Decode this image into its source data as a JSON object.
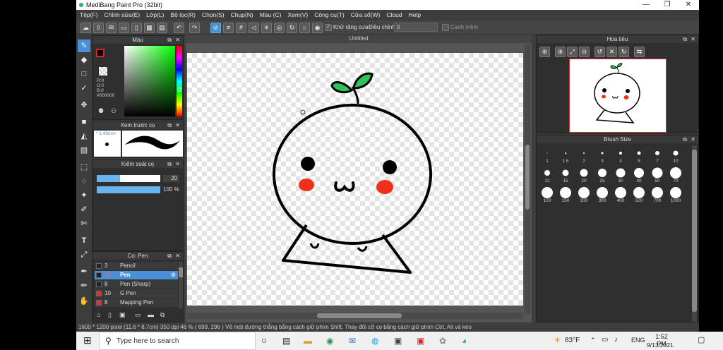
{
  "window": {
    "title": "MediBang Paint Pro (32bit)",
    "min": "—",
    "max": "❐",
    "close": "✕"
  },
  "menu": [
    "Tệp(F)",
    "Chỉnh sửa(E)",
    "Lớp(L)",
    "Bộ lọc(R)",
    "Chọn(S)",
    "Chụp(N)",
    "Màu (C)",
    "Xem(V)",
    "Công cụ(T)",
    "Cửa sổ(W)",
    "Cloud",
    "Help"
  ],
  "toolbar": {
    "antialias_label": "Khử răng cưa",
    "correction_label": "Điều chỉnh",
    "correction_value": "0",
    "soft_edge_label": "Cạnh mềm"
  },
  "color_panel": {
    "title": "Màu",
    "r": "R:0",
    "g": "G:0",
    "b": "B:0",
    "hex": "#000000"
  },
  "brush_preview": {
    "title": "Xem trước cọ",
    "size": "* 1.45mm"
  },
  "brush_control": {
    "title": "Kiểm soát cọ",
    "size_value": "20",
    "opacity_value": "100 %",
    "size_fraction": 0.37,
    "opacity_fraction": 1.0
  },
  "brush_list": {
    "title": "Cọ: Pen",
    "items": [
      {
        "size": "3",
        "name": "Pencil",
        "color": "#222222"
      },
      {
        "size": "20",
        "name": "Pen",
        "color": "#222222"
      },
      {
        "size": "8",
        "name": "Pen (Sharp)",
        "color": "#222222"
      },
      {
        "size": "10",
        "name": "G Pen",
        "color": "#e03030"
      },
      {
        "size": "8",
        "name": "Mapping Pen",
        "color": "#e03030"
      }
    ]
  },
  "document": {
    "tab": "Untitled"
  },
  "navigator": {
    "title": "Hoa tiêu"
  },
  "brush_size": {
    "title": "Brush Size",
    "rows": [
      [
        "1",
        "1.5",
        "2",
        "3",
        "4",
        "5",
        "7",
        "10"
      ],
      [
        "12",
        "15",
        "20",
        "25",
        "30",
        "40",
        "50",
        "70"
      ],
      [
        "100",
        "150",
        "200",
        "300",
        "400",
        "500",
        "700",
        "1000"
      ]
    ]
  },
  "status": {
    "text": "1600 * 1200 pixel  (11.6 * 8.7cm)  350 dpi  46 %  ( 699, 296 )  Vẽ một đường thẳng bằng cách giữ phím Shift, Thay đổi cỡ cọ bằng cách giữ phím Ctrl, Alt và kéo"
  },
  "taskbar": {
    "search_placeholder": "Type here to search",
    "weather": "83°F",
    "language": "ENG",
    "time": "1:52 PM",
    "date": "9/13/2021"
  }
}
